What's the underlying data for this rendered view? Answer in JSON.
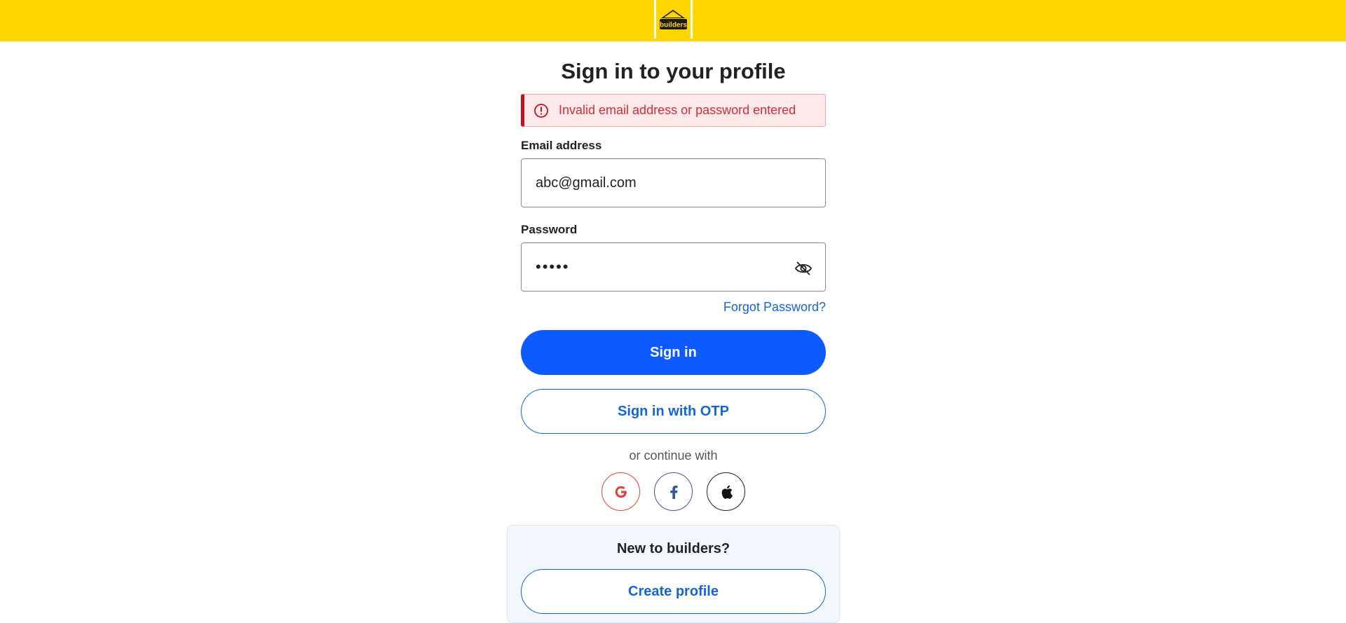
{
  "brand": {
    "logo_text": "builders",
    "header_color": "#ffd600"
  },
  "login": {
    "title": "Sign in to your profile",
    "error_message": "Invalid email address or password entered",
    "email_label": "Email address",
    "email_value": "abc@gmail.com",
    "password_label": "Password",
    "password_value": "•••••",
    "password_toggle_icon": "eye-off-icon",
    "forgot_password": "Forgot Password?",
    "sign_in_button": "Sign in",
    "otp_button": "Sign in with OTP",
    "social_divider": "or continue with",
    "social_providers": [
      "google-icon",
      "facebook-icon",
      "apple-icon"
    ]
  },
  "register": {
    "title": "New to builders?",
    "create_button": "Create profile"
  },
  "colors": {
    "primary": "#0d5bff",
    "link": "#1565d8",
    "error": "#d32f3a",
    "error_bg": "#fde8ea"
  }
}
